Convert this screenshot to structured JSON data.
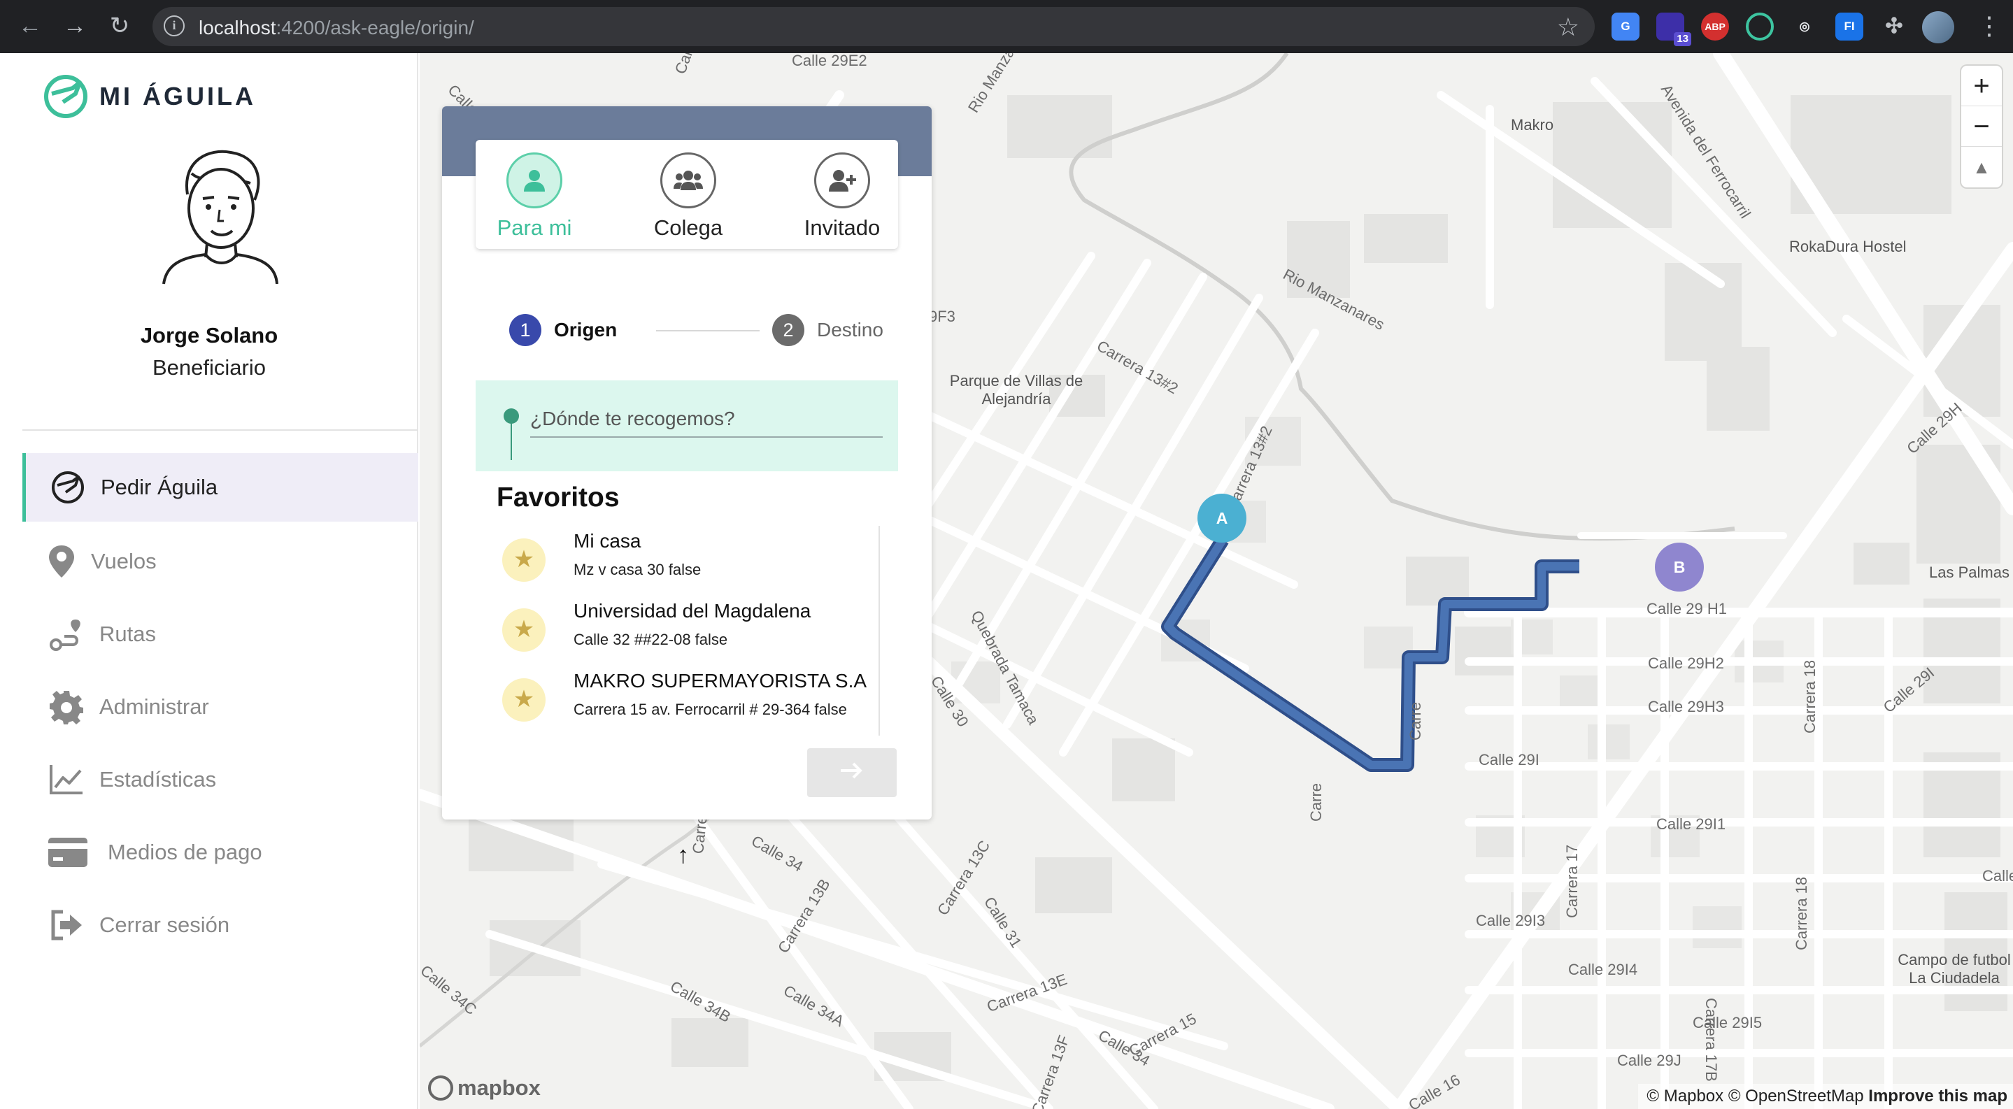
{
  "browser": {
    "url_host": "localhost",
    "url_rest": ":4200/ask-eagle/origin/",
    "extension_badge": "13",
    "ext_abp": "ABP",
    "ext_fi": "FI",
    "ext_g": "G"
  },
  "sidebar": {
    "brand": "MI ÁGUILA",
    "user_name": "Jorge Solano",
    "user_role": "Beneficiario",
    "items": [
      {
        "label": "Pedir Águila",
        "icon": "eagle-icon",
        "active": true
      },
      {
        "label": "Vuelos",
        "icon": "map-pin-icon",
        "active": false
      },
      {
        "label": "Rutas",
        "icon": "route-icon",
        "active": false
      },
      {
        "label": "Administrar",
        "icon": "gear-icon",
        "active": false
      },
      {
        "label": "Estadísticas",
        "icon": "chart-line-icon",
        "active": false
      },
      {
        "label": "Medios de pago",
        "icon": "credit-card-icon",
        "active": false
      },
      {
        "label": "Cerrar sesión",
        "icon": "sign-out-icon",
        "active": false
      }
    ]
  },
  "request": {
    "tabs": [
      {
        "label": "Para mi",
        "icon": "user-icon",
        "active": true
      },
      {
        "label": "Colega",
        "icon": "users-icon",
        "active": false
      },
      {
        "label": "Invitado",
        "icon": "user-plus-icon",
        "active": false
      }
    ],
    "steps": [
      {
        "number": "1",
        "label": "Origen",
        "active": true
      },
      {
        "number": "2",
        "label": "Destino",
        "active": false
      }
    ],
    "origin_placeholder": "¿Dónde te recogemos?",
    "origin_value": "",
    "favorites_title": "Favoritos",
    "favorites": [
      {
        "name": "Mi casa",
        "address": "Mz v casa 30 false"
      },
      {
        "name": "Universidad del Magdalena",
        "address": "Calle 32 ##22-08 false"
      },
      {
        "name": "MAKRO SUPERMAYORISTA S.A",
        "address": "Carrera 15 av. Ferrocarril # 29-364 false"
      }
    ],
    "next_icon": "arrow-right-icon"
  },
  "map": {
    "pin_a": "A",
    "pin_b": "B",
    "route_color": "#4a74b4",
    "places": [
      "Makro",
      "RokaDura Hostel",
      "Parque de Villas de Alejandría",
      "Las Palmas",
      "Campo de futbol La Ciudadela"
    ],
    "streets": [
      "Calle 29E2",
      "Calle",
      "Calle",
      "Rio Manzanares",
      "Avenida del Ferrocarril",
      "Rio Manzanares",
      "Carrera 13#2",
      "Carrera 13#2",
      "9F3",
      "Calle 29H",
      "Calle 29 H1",
      "Calle 29H2",
      "Calle 29H3",
      "Calle 29I",
      "Calle 29I1",
      "Calle 29I3",
      "Calle 29I4",
      "Calle 29I5",
      "Calle 29J",
      "Calle 29I",
      "Calle 2",
      "Carrera 18",
      "Carrera 18",
      "Carrera 17",
      "Carrera 17B",
      "Quebrada Tamaca",
      "Calle 30",
      "Calle 34",
      "Carrera 13B",
      "Carrera 13C",
      "Calle 31",
      "Calle 34A",
      "Calle 34B",
      "Calle 34C",
      "Carrera 13E",
      "Calle 34",
      "Carrera 15",
      "Carrera 13F",
      "Calle 16",
      "Carre",
      "Carre",
      "Carre"
    ],
    "zoom_in": "+",
    "zoom_out": "−",
    "compass": "▲",
    "mapbox": "mapbox",
    "attribution": "© Mapbox © OpenStreetMap",
    "improve": "Improve this map"
  }
}
